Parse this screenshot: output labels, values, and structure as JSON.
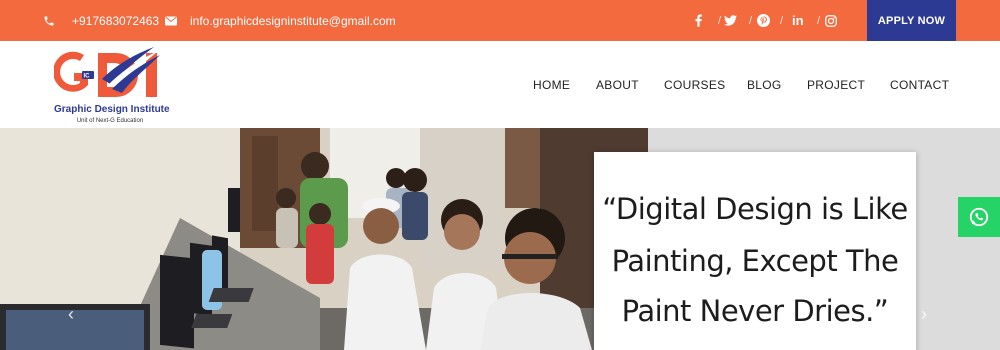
{
  "topbar": {
    "phone": "+917683072463",
    "email": "info.graphicdesigninstitute@gmail.com",
    "social": [
      "facebook-icon",
      "twitter-icon",
      "pinterest-icon",
      "linkedin-icon",
      "instagram-icon"
    ],
    "social_separator": "/",
    "apply_label": "APPLY NOW",
    "bg_color": "#f26a3e",
    "apply_color": "#2d3a94"
  },
  "logo": {
    "letters": "GDI",
    "title": "Graphic Design Institute",
    "subtitle": "Unit of Next-G Education"
  },
  "nav": {
    "items": [
      "HOME",
      "ABOUT",
      "COURSES",
      "BLOG",
      "PROJECT",
      "CONTACT"
    ]
  },
  "hero": {
    "quote_lines": [
      "“Digital Design is Like",
      "Painting, Except The",
      "Paint Never Dries.”"
    ]
  }
}
